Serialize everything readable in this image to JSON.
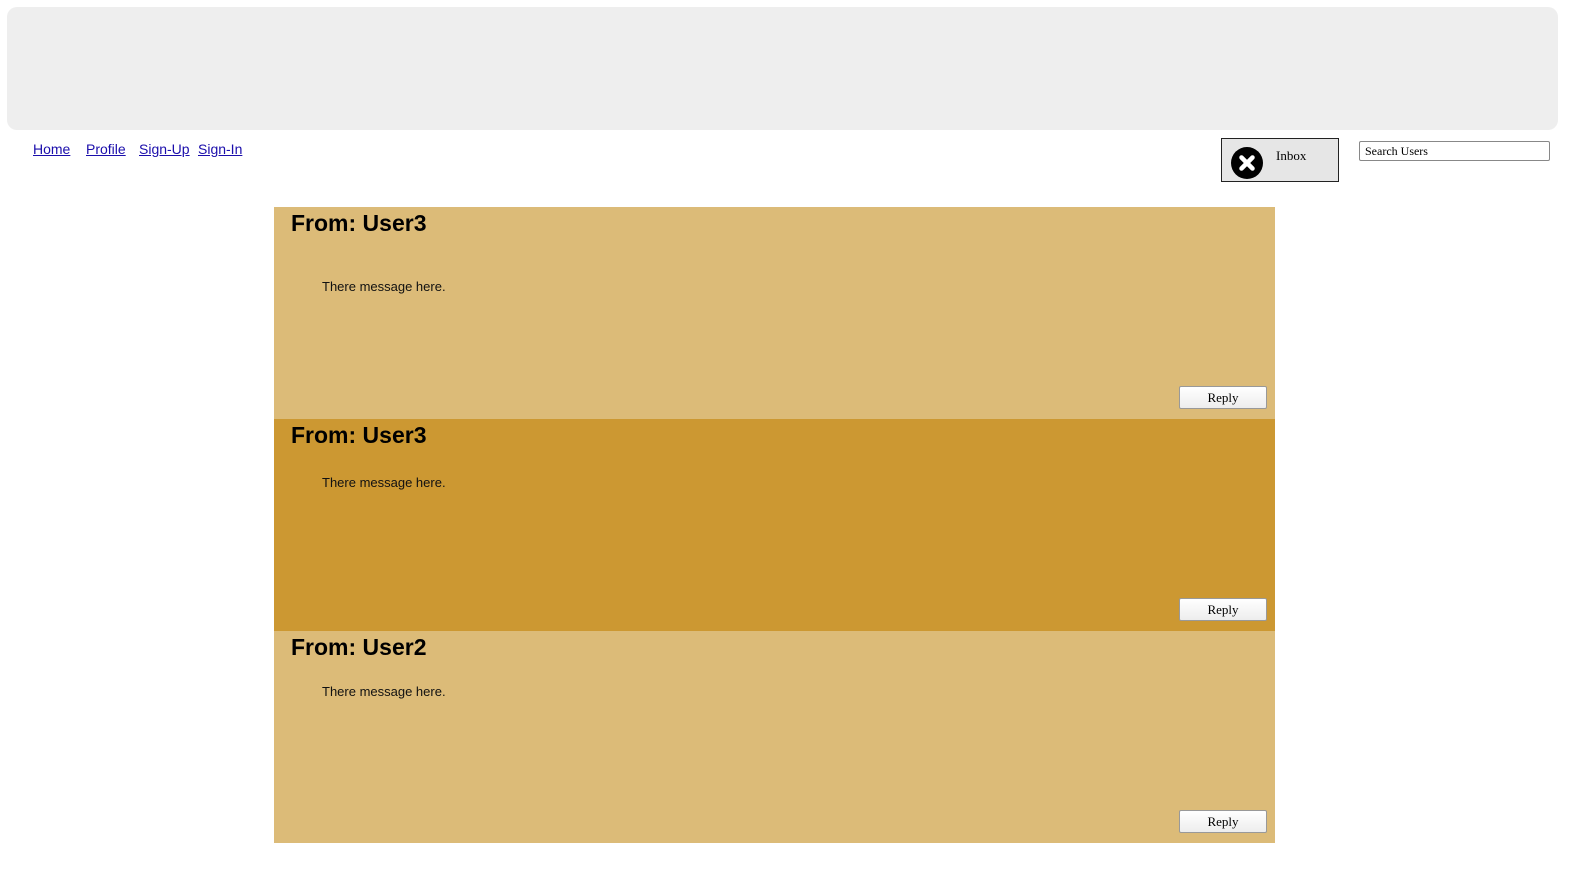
{
  "nav": {
    "items": [
      {
        "label": "Home"
      },
      {
        "label": "Profile"
      },
      {
        "label": "Sign-Up"
      },
      {
        "label": "Sign-In"
      }
    ]
  },
  "inbox": {
    "label": "Inbox",
    "icon": "close-circle-icon"
  },
  "search": {
    "placeholder": "Search Users"
  },
  "messages": [
    {
      "from": "From: User3",
      "body": "There message here.",
      "reply_label": "Reply",
      "color": "#dcbb78"
    },
    {
      "from": "From: User3",
      "body": "There message here.",
      "reply_label": "Reply",
      "color": "#cc9832"
    },
    {
      "from": "From: User2",
      "body": "There message here.",
      "reply_label": "Reply",
      "color": "#dcbb78"
    }
  ],
  "colors": {
    "banner": "#eeeeee",
    "message_light": "#dcbb78",
    "message_dark": "#cc9832",
    "link": "#1a0dab"
  }
}
